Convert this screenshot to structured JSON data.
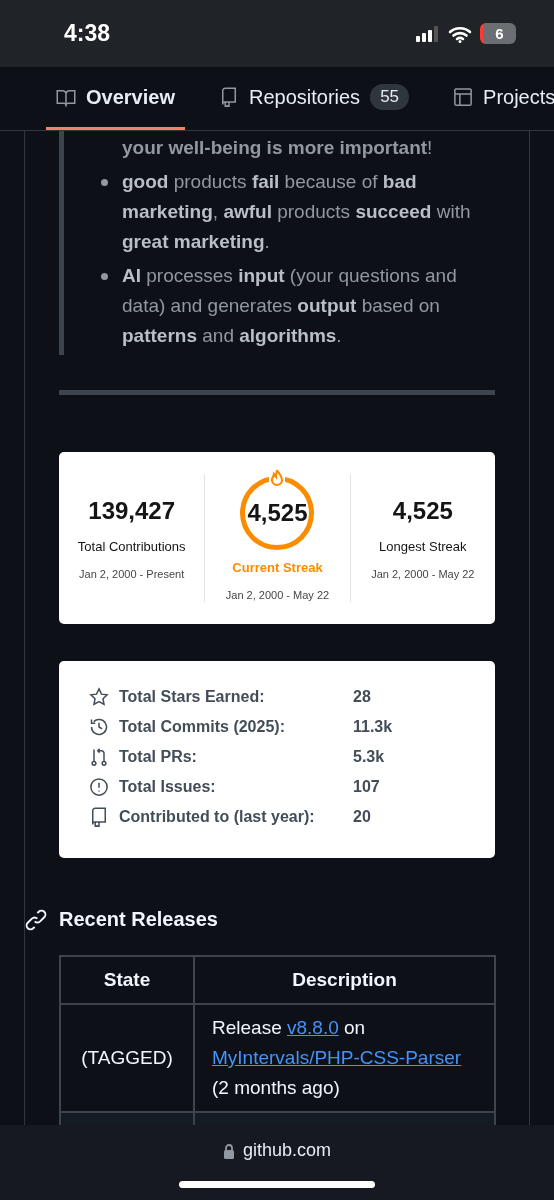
{
  "status_bar": {
    "time": "4:38",
    "battery": "6"
  },
  "tabs": [
    {
      "label": "Overview",
      "selected": true,
      "kind": "book"
    },
    {
      "label": "Repositories",
      "selected": false,
      "kind": "repo",
      "count": "55"
    },
    {
      "label": "Projects",
      "selected": false,
      "kind": "table"
    }
  ],
  "quote": {
    "lead": "**your well-being is more important**!",
    "bullets": [
      "**good** products **fail** because of **bad marketing**, **awful** products **succeed** with **great marketing**.",
      "**AI** processes **input** (your questions and data) and generates **output** based on **patterns** and **algorithms**."
    ]
  },
  "streak_card": {
    "stats": [
      {
        "kind": "plain",
        "value": "139,427",
        "label": "Total Contributions",
        "range": "Jan 2, 2000 - Present"
      },
      {
        "kind": "ring",
        "value": "4,525",
        "label": "Current Streak",
        "range": "Jan 2, 2000 - May 22"
      },
      {
        "kind": "plain",
        "value": "4,525",
        "label": "Longest Streak",
        "range": "Jan 2, 2000 - May 22"
      }
    ]
  },
  "stats_card": {
    "rows": [
      {
        "kind": "star",
        "label": "Total Stars Earned:",
        "value": "28"
      },
      {
        "kind": "history",
        "label": "Total Commits (2025):",
        "value": "11.3k"
      },
      {
        "kind": "pr",
        "label": "Total PRs:",
        "value": "5.3k"
      },
      {
        "kind": "issue",
        "label": "Total Issues:",
        "value": "107"
      },
      {
        "kind": "repo",
        "label": "Contributed to (last year):",
        "value": "20"
      }
    ]
  },
  "releases": {
    "title": "Recent Releases",
    "columns": [
      "State",
      "Description"
    ],
    "rows": [
      {
        "state": "(TAGGED)",
        "description": [
          {
            "kind": "text",
            "text": "Release"
          },
          {
            "kind": "link",
            "text": "v8.8.0"
          },
          {
            "kind": "text",
            "text": "on"
          },
          {
            "kind": "link",
            "text": "MyIntervals/PHP-CSS-Parser"
          },
          {
            "kind": "text",
            "text": "(2 months ago)"
          }
        ]
      }
    ]
  },
  "address_bar": {
    "domain": "github.com"
  }
}
